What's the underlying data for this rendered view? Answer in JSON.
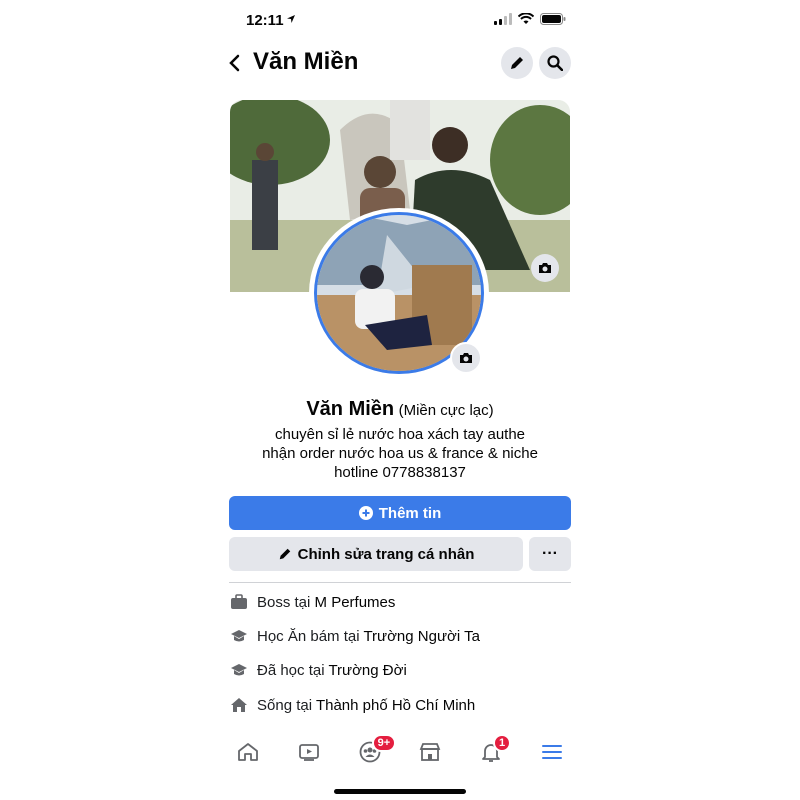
{
  "status_bar": {
    "time": "12:11"
  },
  "header": {
    "title": "Văn Miền"
  },
  "profile": {
    "name": "Văn Miền",
    "nickname": "(Miền cực lạc)",
    "bio_lines": [
      "chuyên sỉ lẻ nước hoa xách tay authe",
      "nhận order nước hoa us & france & niche",
      "hotline 0778838137"
    ]
  },
  "actions": {
    "add_story_label": "Thêm tin",
    "edit_profile_label": "Chỉnh sửa trang cá nhân",
    "more_label": "···"
  },
  "details": [
    {
      "icon": "briefcase-icon",
      "prefix": "Boss tại ",
      "value": "M Perfumes"
    },
    {
      "icon": "graduation-cap-icon",
      "prefix": "Học Ăn bám tại ",
      "value": "Trường Người Ta"
    },
    {
      "icon": "graduation-cap-icon",
      "prefix": "Đã học tại ",
      "value": "Trường Đời"
    },
    {
      "icon": "house-icon",
      "prefix": "Sống tại ",
      "value": "Thành phố Hồ Chí Minh"
    }
  ],
  "tab_bar": {
    "groups_badge": "9+",
    "notifications_badge": "1"
  },
  "colors": {
    "accent": "#3b7be8",
    "button_bg": "#e4e6eb",
    "badge": "#e41e3f"
  }
}
